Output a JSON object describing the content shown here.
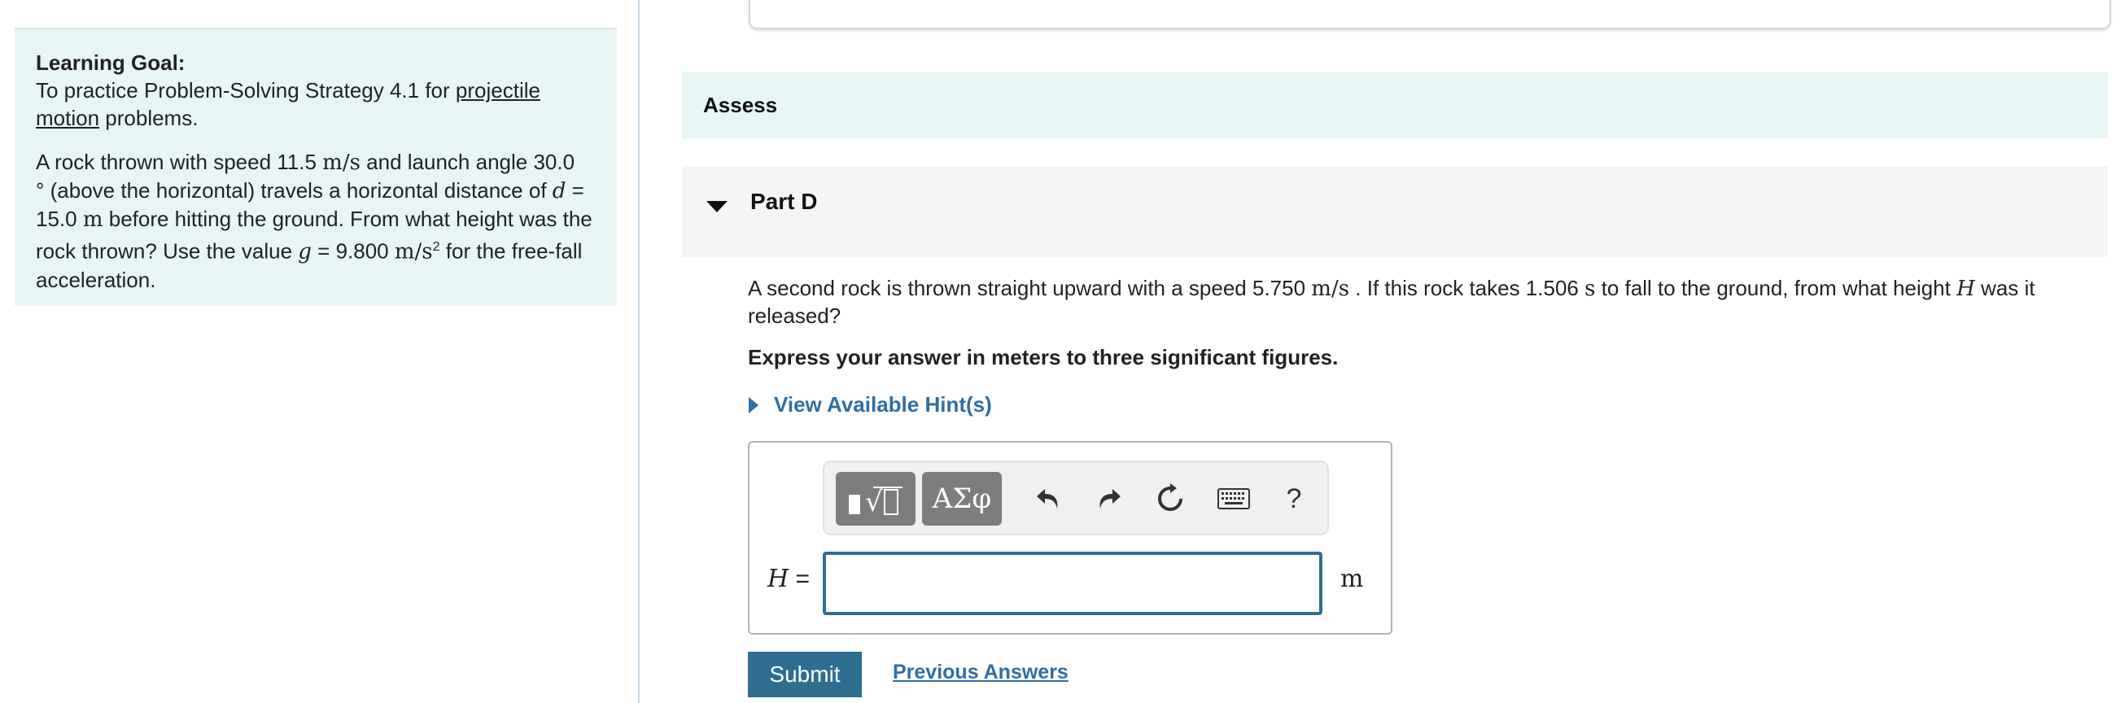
{
  "learning_goal": {
    "title": "Learning Goal:",
    "intro": "To practice Problem-Solving Strategy 4.1 for",
    "link_line1": "projectile",
    "link_line2": "motion",
    "intro_end": "problems.",
    "problem": {
      "l1_a": "A rock thrown with speed 11.5",
      "l1_unit": "m/s",
      "l1_b": "and launch angle 30.0",
      "l2_deg": "°",
      "l2_a": "(above the horizontal) travels a horizontal distance of",
      "l2_var": "d",
      "l2_eq": "=",
      "l3_num": "15.0",
      "l3_unit": "m",
      "l3_b": "before hitting the ground. From what height was the",
      "l4_a": "rock thrown? Use the value",
      "l4_var": "g",
      "l4_eq": "= 9.800",
      "l4_unit": "m/s",
      "l4_sup": "2",
      "l4_b": "for the free-fall",
      "l5": "acceleration."
    }
  },
  "assess": {
    "label": "Assess"
  },
  "part": {
    "title": "Part D",
    "question": {
      "a": "A second rock is thrown straight upward with a speed 5.750",
      "unit1": "m/s",
      "b": ". If this rock takes 1.506",
      "unit2": "s",
      "c": "to fall to the ground, from what height",
      "var": "H",
      "d": "was it released?"
    },
    "instruction": "Express your answer in meters to three significant figures.",
    "hints_label": "View Available Hint(s)"
  },
  "answer": {
    "variable": "H",
    "equals": "=",
    "value": "",
    "unit": "m"
  },
  "toolbar": {
    "symbols_label": "ΑΣφ",
    "help_label": "?"
  },
  "actions": {
    "submit_label": "Submit",
    "previous_answers_label": "Previous Answers"
  },
  "colors": {
    "goal_bg": "#e8f5f5",
    "assess_bg": "#e8f5f5",
    "part_bg": "#f5f5f5",
    "link_blue": "#2f6ea3",
    "submit_bg": "#2d6e91"
  }
}
